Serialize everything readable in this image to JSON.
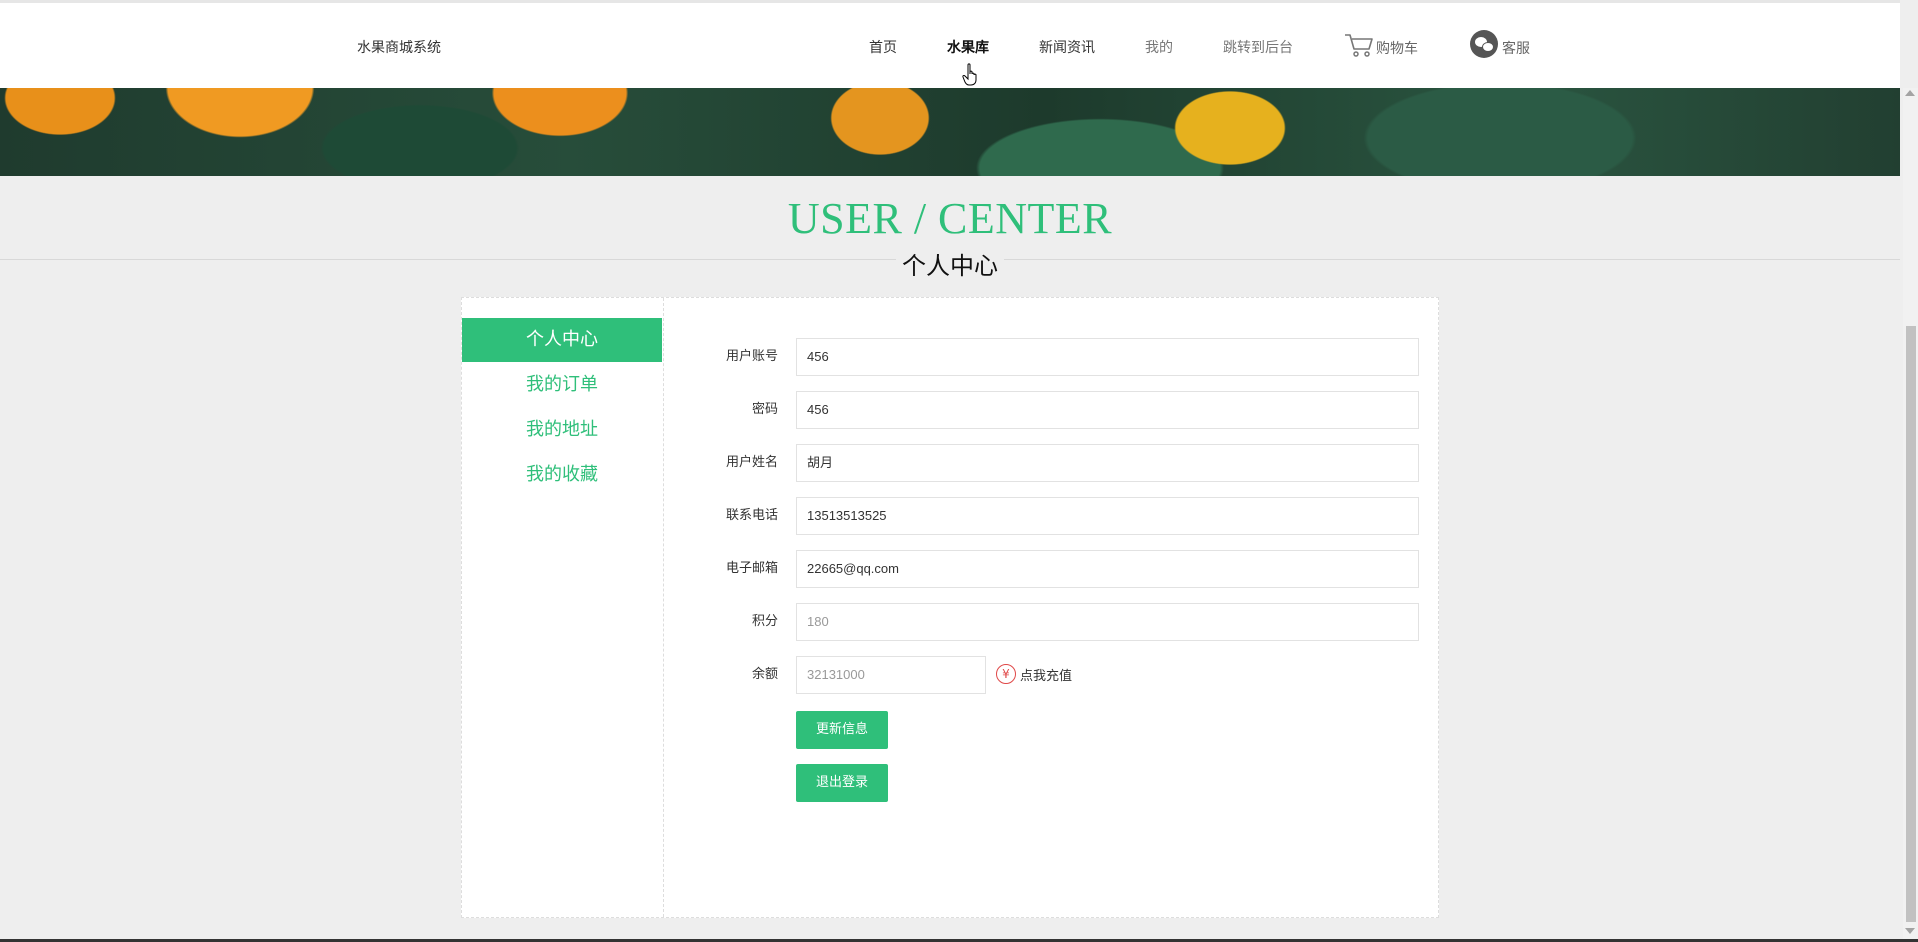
{
  "header": {
    "brand": "水果商城系统",
    "nav": {
      "home": "首页",
      "fruit": "水果库",
      "news": "新闻资讯",
      "mine": "我的",
      "admin": "跳转到后台",
      "cart": "购物车",
      "service": "客服"
    }
  },
  "page": {
    "title_en": "USER / CENTER",
    "title_cn": "个人中心"
  },
  "sidebar": {
    "items": [
      {
        "label": "个人中心",
        "active": true
      },
      {
        "label": "我的订单",
        "active": false
      },
      {
        "label": "我的地址",
        "active": false
      },
      {
        "label": "我的收藏",
        "active": false
      }
    ]
  },
  "form": {
    "account": {
      "label": "用户账号",
      "value": "456"
    },
    "password": {
      "label": "密码",
      "value": "456"
    },
    "name": {
      "label": "用户姓名",
      "value": "胡月"
    },
    "phone": {
      "label": "联系电话",
      "value": "13513513525"
    },
    "email": {
      "label": "电子邮箱",
      "value": "22665@qq.com"
    },
    "points": {
      "label": "积分",
      "value": "180"
    },
    "balance": {
      "label": "余额",
      "value": "32131000"
    },
    "recharge": {
      "icon": "¥",
      "label": "点我充值"
    },
    "update_button": "更新信息",
    "logout_button": "退出登录"
  },
  "colors": {
    "accent": "#2fbf7a",
    "recharge_icon": "#e04848"
  }
}
